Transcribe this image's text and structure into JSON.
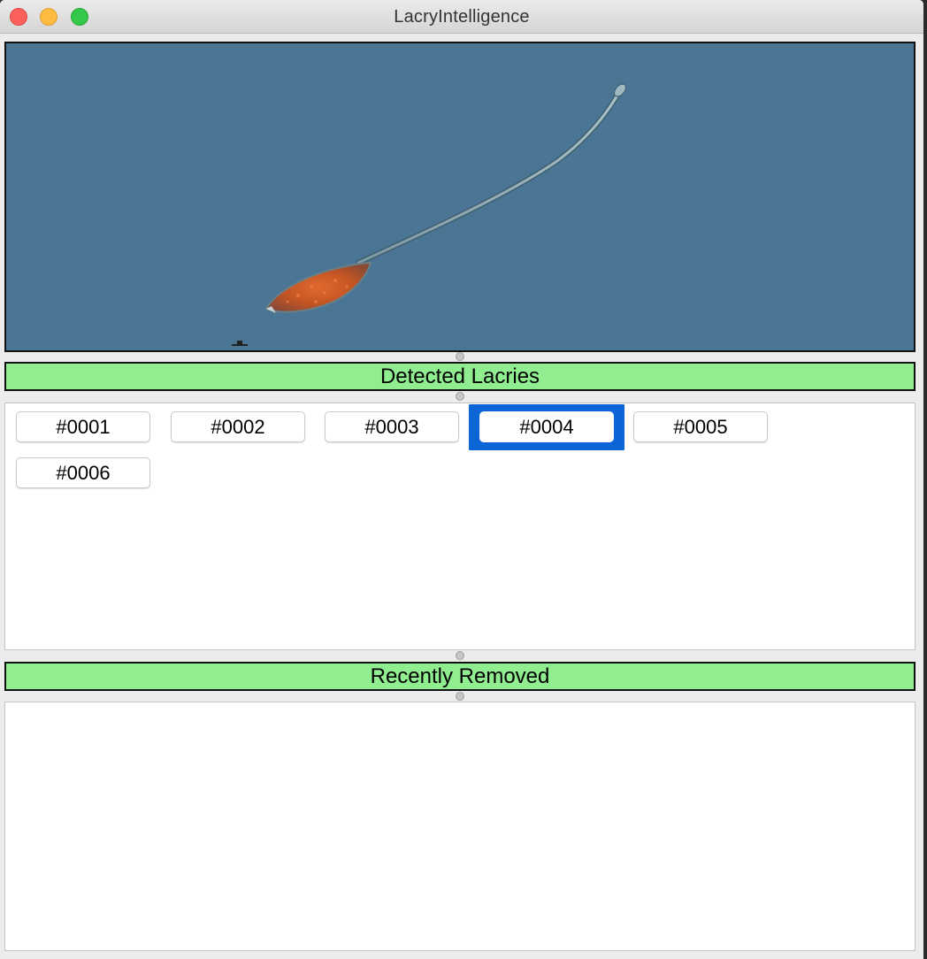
{
  "window": {
    "title": "LacryIntelligence"
  },
  "image_viewer": {
    "subject": "lacrymaria organism micrograph",
    "background_color": "#4a7595"
  },
  "detected": {
    "header": "Detected Lacries",
    "items": [
      "#0001",
      "#0002",
      "#0003",
      "#0004",
      "#0005",
      "#0006"
    ],
    "selected": "#0004"
  },
  "removed": {
    "header": "Recently Removed",
    "items": []
  },
  "colors": {
    "header_bg": "#90ee90",
    "selection": "#0b65d6"
  }
}
